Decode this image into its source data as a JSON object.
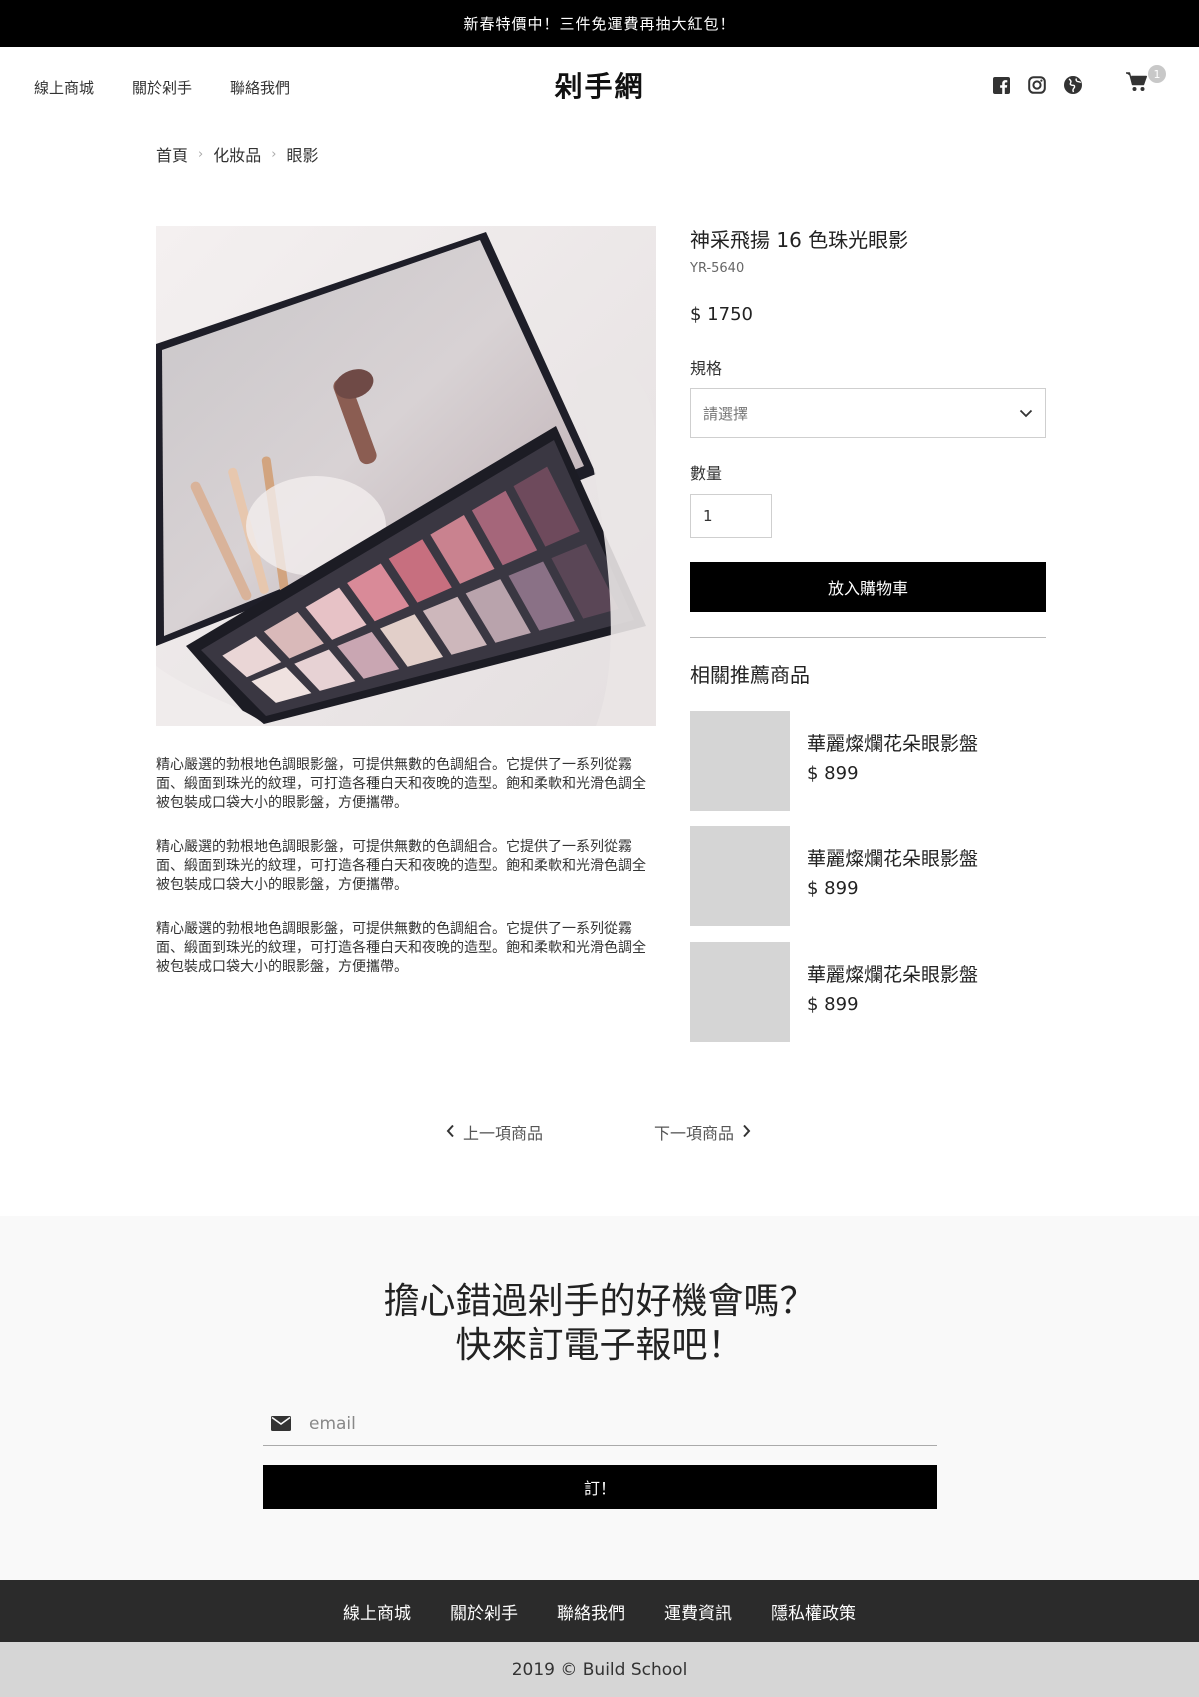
{
  "promo": {
    "text": "新春特價中！三件免運費再抽大紅包！"
  },
  "header": {
    "nav": [
      "線上商城",
      "關於剁手",
      "聯絡我們"
    ],
    "logo": "剁手網",
    "icons": [
      "facebook-icon",
      "instagram-icon",
      "globe-icon"
    ],
    "cart_count": "1"
  },
  "breadcrumb": [
    "首頁",
    "化妝品",
    "眼影"
  ],
  "product": {
    "title": "神采飛揚 16 色珠光眼影",
    "code": "YR-5640",
    "price": "$ 1750",
    "spec_label": "規格",
    "spec_placeholder": "請選擇",
    "qty_label": "數量",
    "qty_value": "1",
    "add_to_cart": "放入購物車",
    "description": [
      "精心嚴選的勃根地色調眼影盤，可提供無數的色調組合。它提供了一系列從霧面、緞面到珠光的紋理，可打造各種白天和夜晚的造型。飽和柔軟和光滑色調全被包裝成口袋大小的眼影盤，方便攜帶。",
      "精心嚴選的勃根地色調眼影盤，可提供無數的色調組合。它提供了一系列從霧面、緞面到珠光的紋理，可打造各種白天和夜晚的造型。飽和柔軟和光滑色調全被包裝成口袋大小的眼影盤，方便攜帶。",
      "精心嚴選的勃根地色調眼影盤，可提供無數的色調組合。它提供了一系列從霧面、緞面到珠光的紋理，可打造各種白天和夜晚的造型。飽和柔軟和光滑色調全被包裝成口袋大小的眼影盤，方便攜帶。"
    ]
  },
  "related": {
    "title": "相關推薦商品",
    "items": [
      {
        "name": "華麗燦爛花朵眼影盤",
        "price": "$ 899"
      },
      {
        "name": "華麗燦爛花朵眼影盤",
        "price": "$ 899"
      },
      {
        "name": "華麗燦爛花朵眼影盤",
        "price": "$ 899"
      }
    ]
  },
  "pager": {
    "prev": "上一項商品",
    "next": "下一項商品"
  },
  "newsletter": {
    "title_line1": "擔心錯過剁手的好機會嗎？",
    "title_line2": "快來訂電子報吧！",
    "email_placeholder": "email",
    "button": "訂！"
  },
  "footer": {
    "nav": [
      "線上商城",
      "關於剁手",
      "聯絡我們",
      "運費資訊",
      "隱私權政策"
    ],
    "copyright": "2019 © Build School"
  },
  "colors": {
    "primary": "#000000",
    "footer_dark": "#2b2b2b",
    "footer_light": "#d6d6d6",
    "placeholder": "#d5d5d5"
  }
}
